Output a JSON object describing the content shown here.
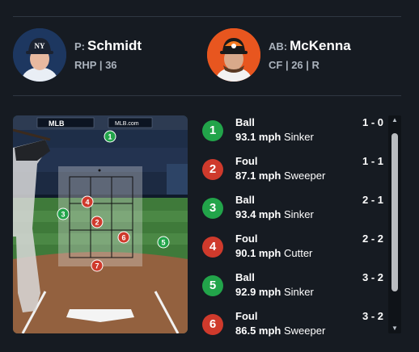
{
  "header": {
    "pitcher": {
      "role": "P:",
      "name": "Schmidt",
      "details": "RHP | 36",
      "team_logo": "NY"
    },
    "batter": {
      "role": "AB:",
      "name": "McKenna",
      "details": "CF | 26 | R"
    }
  },
  "field": {
    "ad_text": "MLB.com",
    "logo_text": "MLB"
  },
  "colors": {
    "ball": "#22a44a",
    "strike": "#cf3a2c"
  },
  "pitches": [
    {
      "num": "1",
      "result": "Ball",
      "speed": "93.1 mph",
      "type": "Sinker",
      "count": "1 - 0",
      "kind": "ball"
    },
    {
      "num": "2",
      "result": "Foul",
      "speed": "87.1 mph",
      "type": "Sweeper",
      "count": "1 - 1",
      "kind": "strike"
    },
    {
      "num": "3",
      "result": "Ball",
      "speed": "93.4 mph",
      "type": "Sinker",
      "count": "2 - 1",
      "kind": "ball"
    },
    {
      "num": "4",
      "result": "Foul",
      "speed": "90.1 mph",
      "type": "Cutter",
      "count": "2 - 2",
      "kind": "strike"
    },
    {
      "num": "5",
      "result": "Ball",
      "speed": "92.9 mph",
      "type": "Sinker",
      "count": "3 - 2",
      "kind": "ball"
    },
    {
      "num": "6",
      "result": "Foul",
      "speed": "86.5 mph",
      "type": "Sweeper",
      "count": "3 - 2",
      "kind": "strike"
    }
  ],
  "zone_markers": [
    {
      "num": "1",
      "kind": "ball"
    },
    {
      "num": "4",
      "kind": "strike"
    },
    {
      "num": "3",
      "kind": "ball"
    },
    {
      "num": "2",
      "kind": "strike"
    },
    {
      "num": "6",
      "kind": "strike"
    },
    {
      "num": "5",
      "kind": "ball"
    },
    {
      "num": "7",
      "kind": "strike"
    }
  ]
}
